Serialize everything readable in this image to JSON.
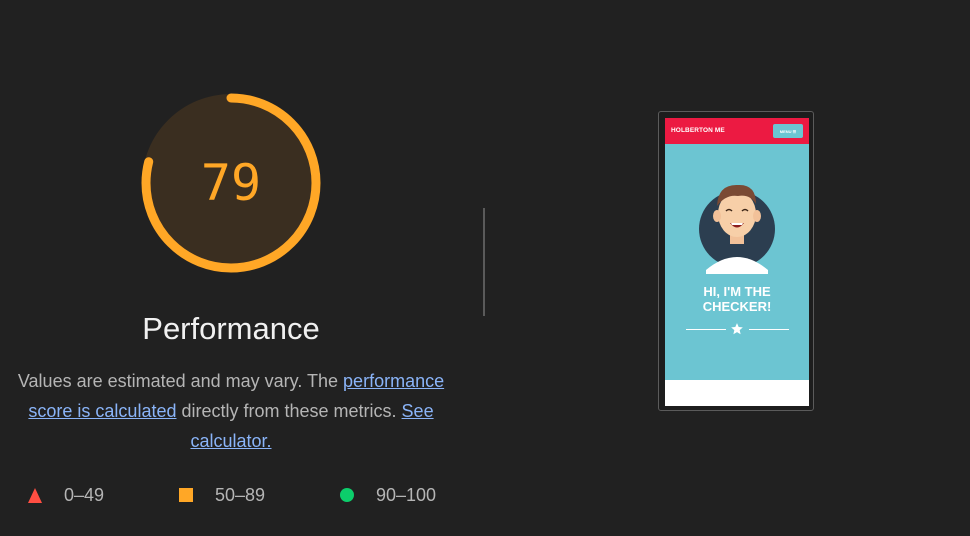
{
  "gauge": {
    "score": "79",
    "fraction": 0.79,
    "color": "#ffa726",
    "track_color": "#3a2e20"
  },
  "category": {
    "title": "Performance"
  },
  "description": {
    "text1": "Values are estimated and may vary. The ",
    "link1": "performance score is calculated",
    "text2": " directly from these metrics. ",
    "link2": "See calculator."
  },
  "legend": [
    {
      "range": "0–49",
      "shape": "triangle",
      "color": "#ff4e42"
    },
    {
      "range": "50–89",
      "shape": "square",
      "color": "#ffa726"
    },
    {
      "range": "90–100",
      "shape": "circle",
      "color": "#0cce6b"
    }
  ],
  "screenshot": {
    "brand": "HOLBERTON ME",
    "menu": "MENU ☰",
    "headline_line1": "HI, I'M THE",
    "headline_line2": "CHECKER!",
    "header_color": "#ec1a42",
    "hero_color": "#6cc5d2"
  }
}
